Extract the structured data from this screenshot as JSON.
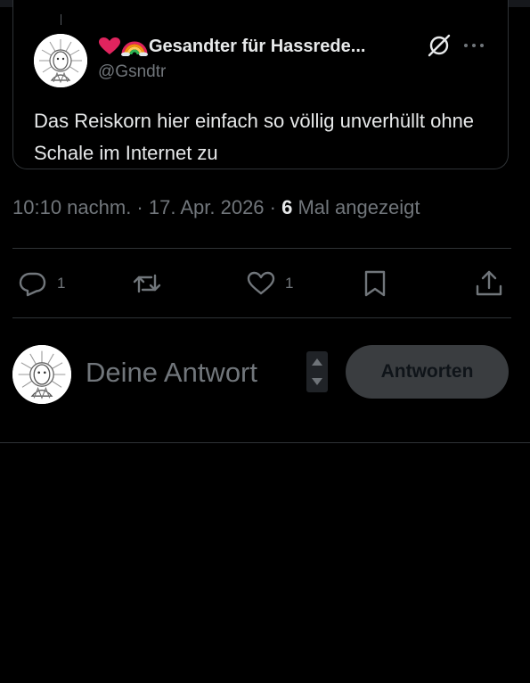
{
  "quoted_tweet": {
    "author_name": "Gesandter für Hassrede...",
    "author_handle": "@Gsndtr",
    "text": "Das Reiskorn hier einfach so völlig unverhüllt ohne Schale im Internet zu",
    "name_emojis": [
      "red-heart",
      "rainbow"
    ],
    "icons": [
      "grok-icon",
      "more-icon"
    ]
  },
  "tweet_meta": {
    "time": "10:10 nachm.",
    "separator1": " · ",
    "date": "17. Apr. 2026",
    "separator2": " · ",
    "views_count": "6",
    "views_label": " Mal angezeigt"
  },
  "actions": {
    "reply": {
      "icon": "reply-icon",
      "count": "1"
    },
    "retweet": {
      "icon": "retweet-icon",
      "count": ""
    },
    "like": {
      "icon": "heart-icon",
      "count": "1"
    },
    "bookmark": {
      "icon": "bookmark-icon"
    },
    "share": {
      "icon": "share-icon"
    }
  },
  "reply_composer": {
    "placeholder": "Deine Antwort",
    "value": "",
    "button_label": "Antworten"
  },
  "colors": {
    "background": "#000000",
    "text_primary": "#e7e9ea",
    "text_secondary": "#71767b",
    "border": "#2f3336",
    "button_disabled_bg": "#3a3d40"
  }
}
